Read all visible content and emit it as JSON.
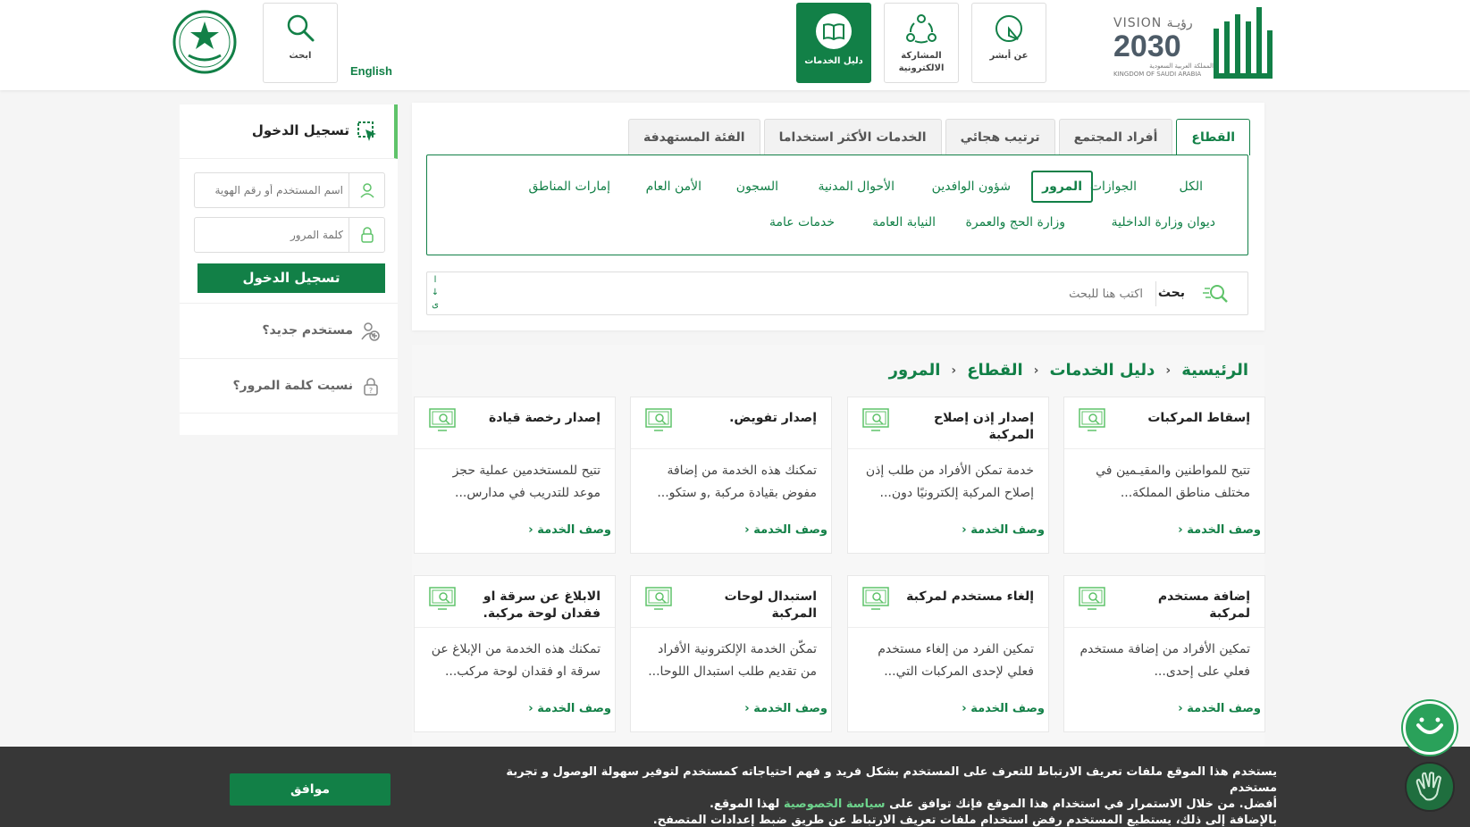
{
  "header": {
    "vision_top": "VISION رؤيـة",
    "vision_year": "2030",
    "vision_kingdom_ar": "المملكة العربية السعودية",
    "vision_kingdom_en": "KINGDOM OF SAUDI ARABIA",
    "nav": [
      {
        "label": "عن أبشر",
        "icon": "absher-info-icon"
      },
      {
        "label": "المشاركة الالكترونية",
        "icon": "e-participation-icon"
      },
      {
        "label": "دليل الخدمات",
        "icon": "services-guide-icon",
        "active": true
      }
    ],
    "search_label": "ابحث",
    "language_link": "English"
  },
  "tabs": [
    "القطاع",
    "أفراد المجتمع",
    "ترتيب هجائي",
    "الخدمات الأكثر استخداما",
    "الفئة المستهدفة"
  ],
  "sectors": {
    "row1": [
      "الكل",
      "الجوازات",
      "المرور",
      "شؤون الوافدين",
      "الأحوال المدنية",
      "السجون",
      "الأمن العام",
      "إمارات المناطق"
    ],
    "row2": [
      "ديوان وزارة الداخلية",
      "وزارة الحج والعمرة",
      "النيابة العامة",
      "خدمات عامة"
    ],
    "active": "المرور"
  },
  "search": {
    "label": "بحث",
    "placeholder": "اكتب هنا للبحث",
    "keyboard_hint": "ا ↓ ى"
  },
  "breadcrumb": [
    "الرئيسية",
    "دليل الخدمات",
    "القطاع",
    "المرور"
  ],
  "cards": [
    {
      "title": "إسقاط المركبات",
      "desc": "تتيح للمواطنين والمقيـمين في مختلف مناطق المملكة...",
      "link": "وصف الخدمة"
    },
    {
      "title": "إصدار إذن إصلاح المركبة",
      "desc": "خدمة تمكن الأفراد من طلب إذن إصلاح المركبة إلكترونيًا دون...",
      "link": "وصف الخدمة"
    },
    {
      "title": "إصدار تفويض.",
      "desc": "تمكنك هذه الخدمة من إضافة مفوض بقيادة مركبة ,و ستكو...",
      "link": "وصف الخدمة"
    },
    {
      "title": "إصدار رخصة قيادة",
      "desc": "تتيح للمستخدمين عملية حجز موعد للتدريب في مدارس...",
      "link": "وصف الخدمة"
    },
    {
      "title": "إضافة مستخدم لمركبة",
      "desc": "تمكين الأفراد من إضافة مستخدم فعلي على إحدى...",
      "link": "وصف الخدمة"
    },
    {
      "title": "إلغاء مستخدم لمركبة",
      "desc": "تمكين الفرد من إلغاء مستخدم فعلي لإحدى المركبات التي...",
      "link": "وصف الخدمة"
    },
    {
      "title": "استبدال لوحات المركبة",
      "desc": "تمكّن الخدمة الإلكترونية الأفراد من تقديم طلب استبدال اللوحا...",
      "link": "وصف الخدمة"
    },
    {
      "title": "الابلاغ عن سرقة او فقدان لوحة مركبة.",
      "desc": "تمكنك هذه الخدمة من الإبلاغ عن سرقة او فقدان لوحة مركب...",
      "link": "وصف الخدمة"
    }
  ],
  "login": {
    "title": "تسجيل الدخول",
    "username_placeholder": "اسم المستخدم أو رقم الهوية",
    "password_placeholder": "كلمة المرور",
    "submit": "تسجيل الدخول",
    "new_user": "مستخدم جديد؟",
    "forgot_password": "نسيت كلمة المرور؟"
  },
  "cookie": {
    "line1": "يستخدم هذا الموقع ملفات تعريف الارتباط للتعرف على المستخدم بشكل فريد و فهم احتياجاته كمستخدم لتوفير سهولة الوصول و تجربة مستخدم",
    "line2_pre": "أفضل. من خلال الاستمرار في استخدام هذا الموقع فإنك توافق على",
    "privacy_link": "سياسة الخصوصية",
    "line2_post": "لهذا الموقع.",
    "line3": "بالإضافة إلى ذلك، يستطيع المستخدم رفض استخدام ملفات تعريف الارتباط عن طريق ضبط إعدادات المتصفح.",
    "agree": "موافق"
  },
  "colors": {
    "brand": "#128047",
    "accent": "#5fc36a"
  }
}
